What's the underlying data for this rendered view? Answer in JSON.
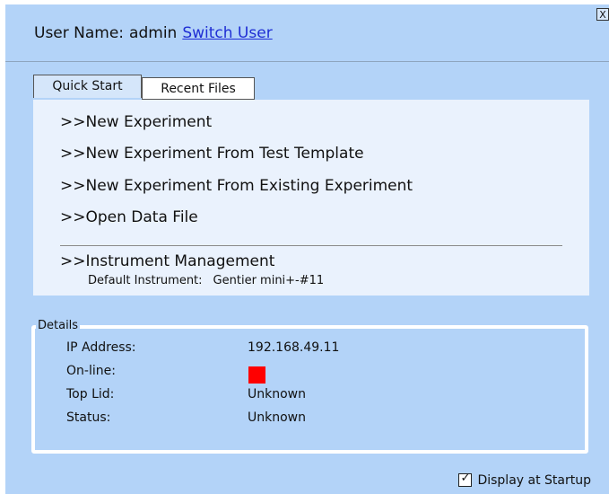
{
  "window": {
    "close_label": "X"
  },
  "user": {
    "label": "User Name:",
    "name": "admin",
    "switch_link": "Switch User"
  },
  "tabs": [
    {
      "label": "Quick Start",
      "active": true
    },
    {
      "label": "Recent Files",
      "active": false
    }
  ],
  "actions": {
    "new_experiment": ">>New Experiment",
    "new_from_template": ">>New Experiment From Test Template",
    "new_from_existing": ">>New Experiment From Existing Experiment",
    "open_data_file": ">>Open Data File",
    "instrument_management": ">>Instrument Management"
  },
  "default_instrument": {
    "label": "Default Instrument:",
    "value": "Gentier mini+-#11"
  },
  "details": {
    "title": "Details",
    "rows": [
      {
        "label": "IP Address:",
        "value": "192.168.49.11"
      },
      {
        "label": "On-line:",
        "value": ""
      },
      {
        "label": "Top Lid:",
        "value": "Unknown"
      },
      {
        "label": "Status:",
        "value": "Unknown"
      }
    ],
    "online_color": "#ff0000"
  },
  "startup": {
    "label": "Display at Startup",
    "checked": true
  },
  "colors": {
    "background": "#b3d3f8",
    "panel": "#eaf2fd",
    "link": "#1f2ed4"
  }
}
